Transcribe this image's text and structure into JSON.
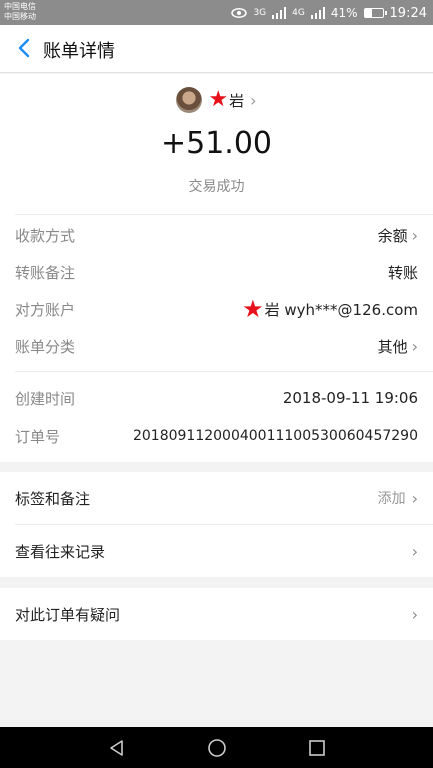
{
  "status_bar": {
    "carrier_1": "中国电信",
    "carrier_2": "中国移动",
    "network_1": "3G",
    "network_2": "4G",
    "battery": "41%",
    "battery_level": 0.41,
    "time": "19:24"
  },
  "header": {
    "title": "账单详情",
    "back_icon": "chevron-left-icon"
  },
  "summary": {
    "counterparty_name": "岩",
    "amount": "+51.00",
    "status": "交易成功"
  },
  "details": [
    {
      "label": "收款方式",
      "value": "余额",
      "has_arrow": true
    },
    {
      "label": "转账备注",
      "value": "转账",
      "has_arrow": false
    },
    {
      "label": "对方账户",
      "value": "岩 wyh***@126.com",
      "has_arrow": false
    },
    {
      "label": "账单分类",
      "value": "其他",
      "has_arrow": true
    }
  ],
  "order": {
    "created_label": "创建时间",
    "created_value": "2018-09-11 19:06",
    "order_label": "订单号",
    "order_value": "2018091120004001110053006045729​0"
  },
  "actions": {
    "tags_label": "标签和备注",
    "tags_action": "添加",
    "history_label": "查看往来记录",
    "question_label": "对此订单有疑问"
  },
  "colors": {
    "accent": "#1a8ff0",
    "redaction": "#e8111b",
    "status_bar": "#8c8c8c"
  }
}
